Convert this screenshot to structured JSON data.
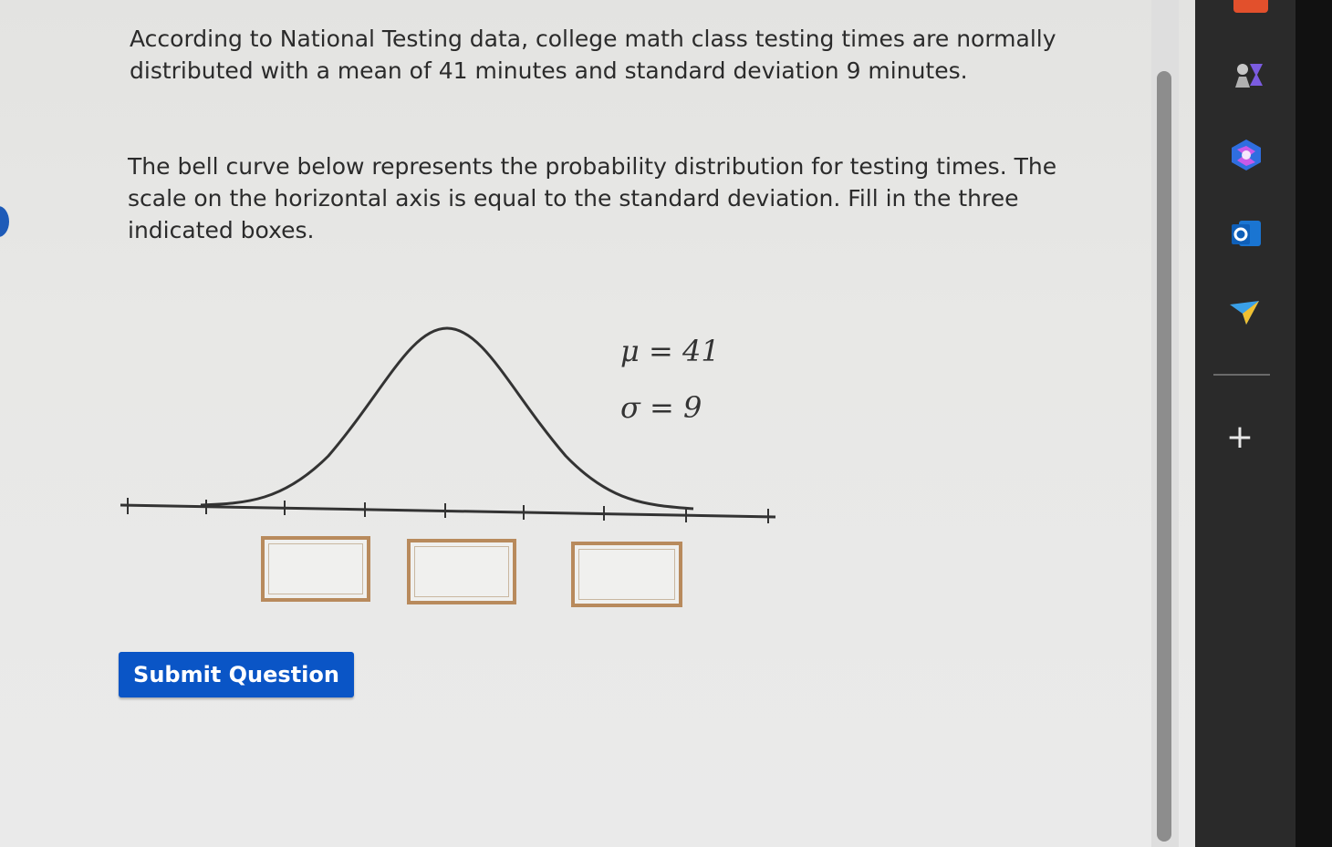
{
  "question": {
    "paragraph1": "According to National Testing data, college math class testing times are normally distributed with a mean of 41 minutes and standard deviation 9 minutes.",
    "paragraph2": "The bell curve below represents the probability distribution for testing times. The scale on the horizontal axis is equal to the standard deviation. Fill in the three indicated boxes."
  },
  "graph": {
    "mu_label": "μ = 41",
    "sigma_label": "σ = 9",
    "mean": 41,
    "std_dev": 9
  },
  "answer_boxes": [
    {
      "value": ""
    },
    {
      "value": ""
    },
    {
      "value": ""
    }
  ],
  "submit_label": "Submit Question",
  "sidebar": {
    "add_label": "+",
    "icons": [
      "app-icon",
      "games-icon",
      "copilot-icon",
      "outlook-icon",
      "send-icon"
    ]
  },
  "colors": {
    "submit_bg": "#0a55c6",
    "box_border": "#b88a5c",
    "sidebar_bg": "#2a2a2a"
  }
}
